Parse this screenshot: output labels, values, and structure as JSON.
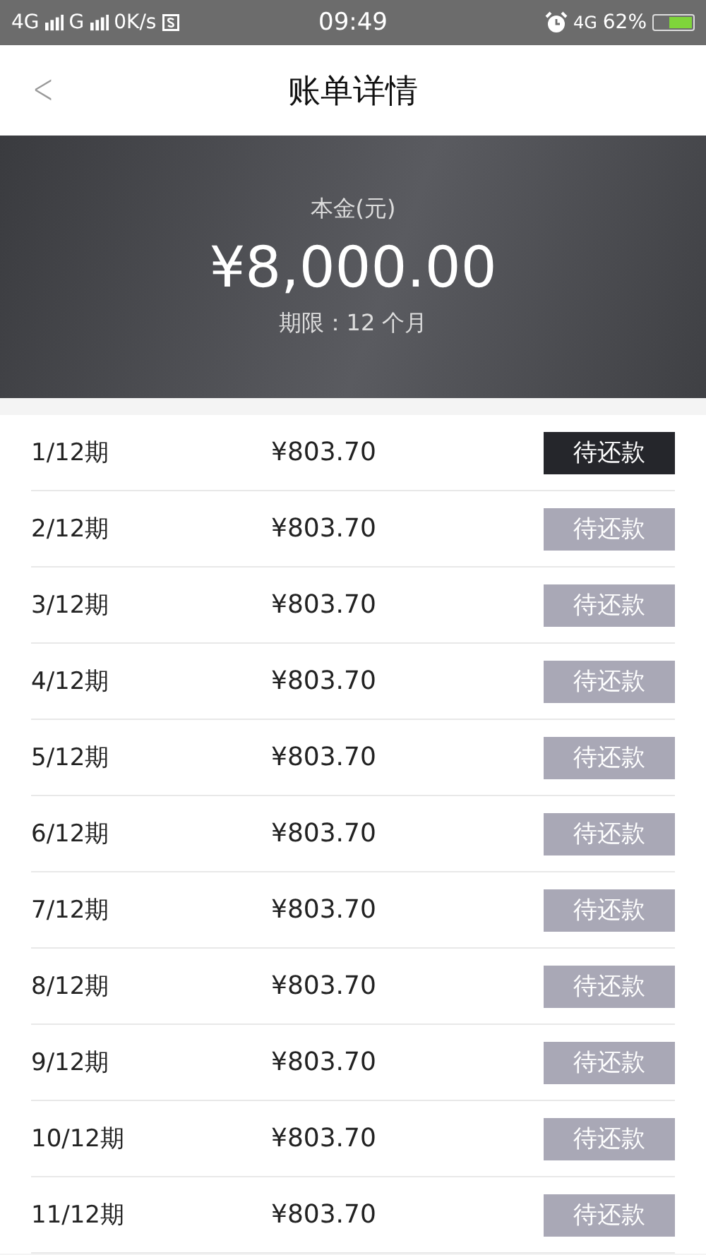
{
  "status_bar": {
    "network_1": "4G",
    "network_2": "G",
    "speed": "0K/s",
    "time": "09:49",
    "network_3": "4G",
    "battery": "62%"
  },
  "header": {
    "back": "<",
    "title": "账单详情"
  },
  "summary": {
    "label": "本金(元)",
    "amount": "¥8,000.00",
    "term": "期限：12 个月"
  },
  "installments": [
    {
      "period": "1/12期",
      "amount": "¥803.70",
      "status": "待还款",
      "current": true
    },
    {
      "period": "2/12期",
      "amount": "¥803.70",
      "status": "待还款",
      "current": false
    },
    {
      "period": "3/12期",
      "amount": "¥803.70",
      "status": "待还款",
      "current": false
    },
    {
      "period": "4/12期",
      "amount": "¥803.70",
      "status": "待还款",
      "current": false
    },
    {
      "period": "5/12期",
      "amount": "¥803.70",
      "status": "待还款",
      "current": false
    },
    {
      "period": "6/12期",
      "amount": "¥803.70",
      "status": "待还款",
      "current": false
    },
    {
      "period": "7/12期",
      "amount": "¥803.70",
      "status": "待还款",
      "current": false
    },
    {
      "period": "8/12期",
      "amount": "¥803.70",
      "status": "待还款",
      "current": false
    },
    {
      "period": "9/12期",
      "amount": "¥803.70",
      "status": "待还款",
      "current": false
    },
    {
      "period": "10/12期",
      "amount": "¥803.70",
      "status": "待还款",
      "current": false
    },
    {
      "period": "11/12期",
      "amount": "¥803.70",
      "status": "待还款",
      "current": false
    }
  ]
}
